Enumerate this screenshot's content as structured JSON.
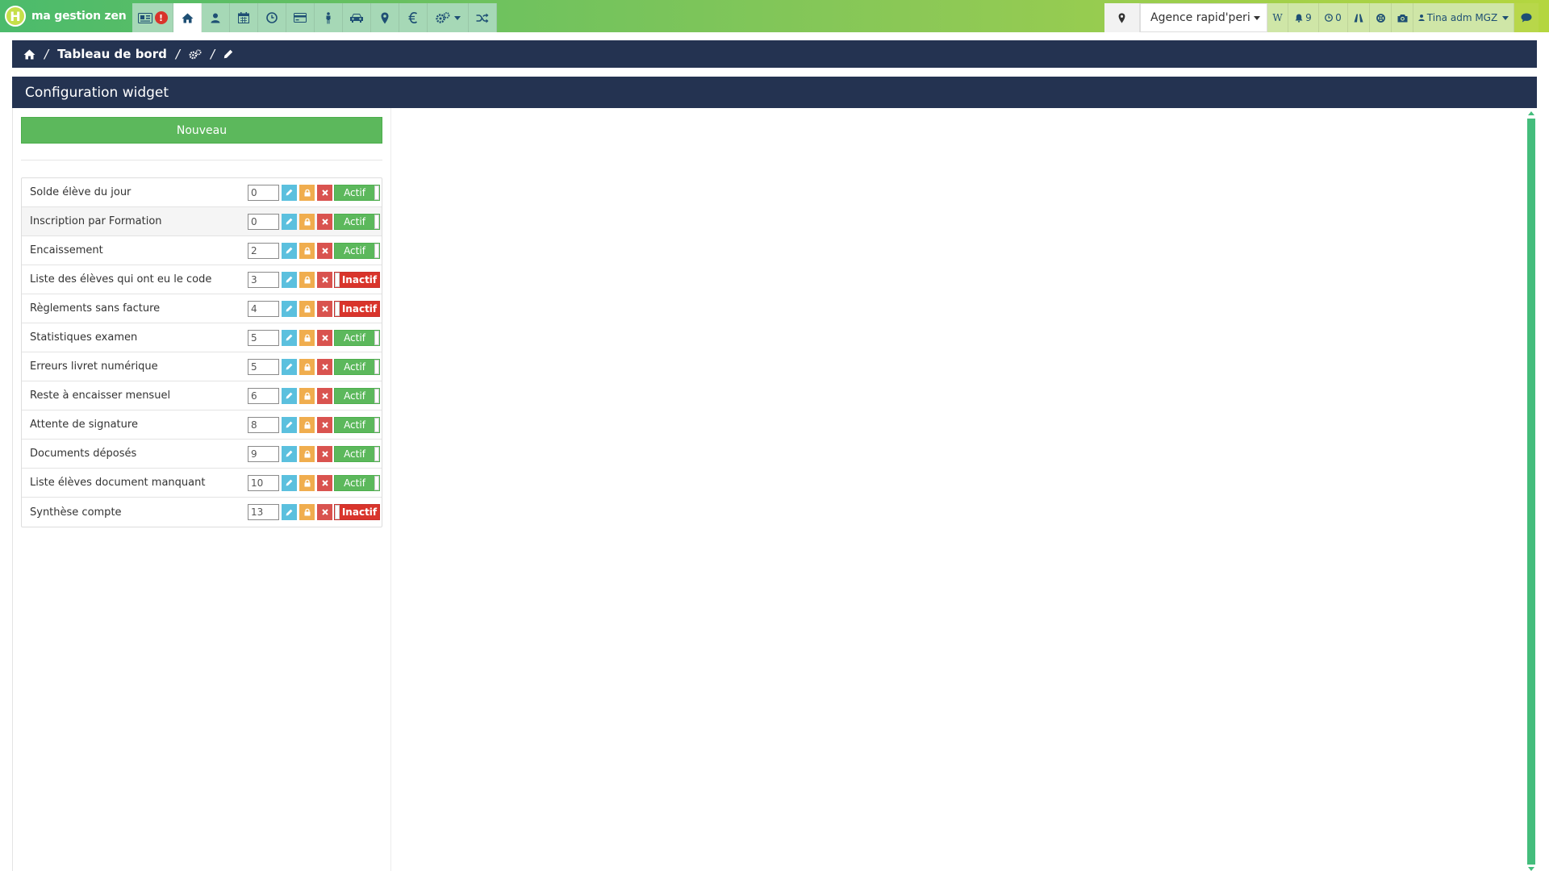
{
  "app": {
    "logo_text": "ma gestion zen",
    "logo_mark": "H"
  },
  "colors": {
    "navy": "#243351",
    "green": "#5cb85c",
    "red": "#d9342b",
    "info": "#5bc0de",
    "warning": "#f0ad4e"
  },
  "topnav": {
    "alert_badge": "!",
    "items": [
      {
        "icon": "id-card-icon"
      },
      {
        "icon": "home-icon"
      },
      {
        "icon": "user-icon"
      },
      {
        "icon": "calendar-icon"
      },
      {
        "icon": "clock-icon"
      },
      {
        "icon": "credit-card-icon"
      },
      {
        "icon": "person-icon"
      },
      {
        "icon": "car-icon"
      },
      {
        "icon": "map-marker-icon"
      },
      {
        "icon": "euro-icon"
      },
      {
        "icon": "gears-dropdown-icon"
      },
      {
        "icon": "shuffle-icon"
      }
    ],
    "agency_select": "Agence rapid'peri",
    "w_label": "W",
    "notifications_count": "9",
    "timers_count": "0",
    "user_name": "Tina adm MGZ"
  },
  "breadcrumb": {
    "title": "Tableau de bord"
  },
  "panel": {
    "title": "Configuration widget",
    "new_button": "Nouveau"
  },
  "widgets": [
    {
      "label": "Solde élève du jour",
      "order": "0",
      "status": "Actif",
      "active": true
    },
    {
      "label": "Inscription par Formation",
      "order": "0",
      "status": "Actif",
      "active": true
    },
    {
      "label": "Encaissement",
      "order": "2",
      "status": "Actif",
      "active": true
    },
    {
      "label": "Liste des élèves qui ont eu le code",
      "order": "3",
      "status": "Inactif",
      "active": false
    },
    {
      "label": "Règlements sans facture",
      "order": "4",
      "status": "Inactif",
      "active": false
    },
    {
      "label": "Statistiques examen",
      "order": "5",
      "status": "Actif",
      "active": true
    },
    {
      "label": "Erreurs livret numérique",
      "order": "5",
      "status": "Actif",
      "active": true
    },
    {
      "label": "Reste à encaisser mensuel",
      "order": "6",
      "status": "Actif",
      "active": true
    },
    {
      "label": "Attente de signature",
      "order": "8",
      "status": "Actif",
      "active": true
    },
    {
      "label": "Documents déposés",
      "order": "9",
      "status": "Actif",
      "active": true
    },
    {
      "label": "Liste élèves document manquant",
      "order": "10",
      "status": "Actif",
      "active": true
    },
    {
      "label": "Synthèse compte",
      "order": "13",
      "status": "Inactif",
      "active": false
    }
  ]
}
